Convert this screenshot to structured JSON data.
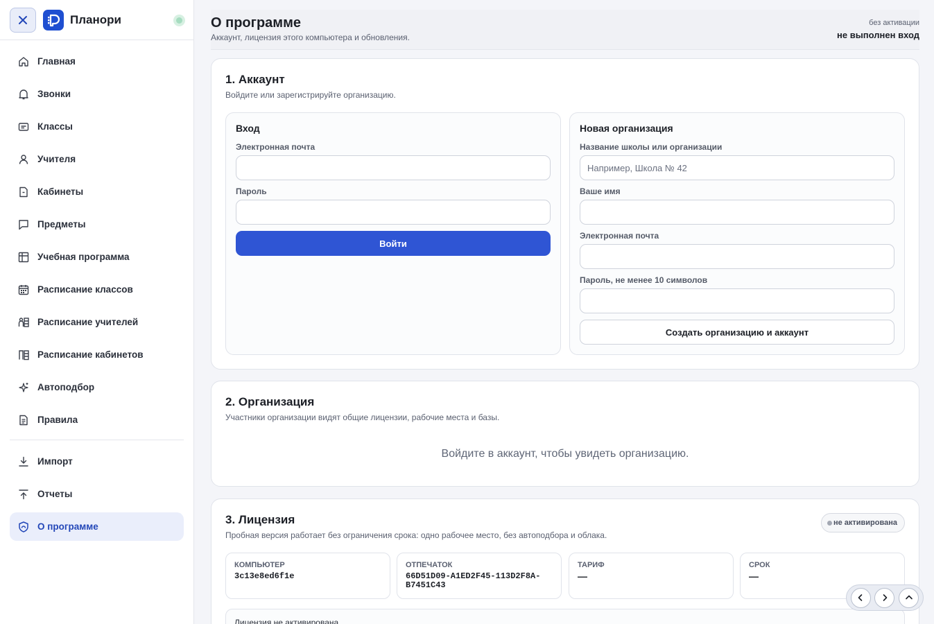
{
  "app": {
    "title": "Планори"
  },
  "sidebar": {
    "items": [
      {
        "label": "Главная",
        "icon": "home-icon"
      },
      {
        "label": "Звонки",
        "icon": "bell-icon"
      },
      {
        "label": "Классы",
        "icon": "class-card-icon"
      },
      {
        "label": "Учителя",
        "icon": "user-icon"
      },
      {
        "label": "Кабинеты",
        "icon": "door-icon"
      },
      {
        "label": "Предметы",
        "icon": "chat-bubble-icon"
      },
      {
        "label": "Учебная программа",
        "icon": "table-grid-icon"
      },
      {
        "label": "Расписание классов",
        "icon": "calendar-icon"
      },
      {
        "label": "Расписание учителей",
        "icon": "teacher-schedule-icon"
      },
      {
        "label": "Расписание кабинетов",
        "icon": "room-schedule-icon"
      },
      {
        "label": "Автоподбор",
        "icon": "sparkles-icon"
      },
      {
        "label": "Правила",
        "icon": "document-icon"
      }
    ],
    "bottom_items": [
      {
        "label": "Импорт",
        "icon": "download-icon"
      },
      {
        "label": "Отчеты",
        "icon": "upload-icon"
      },
      {
        "label": "О программе",
        "icon": "shield-icon",
        "active": true
      }
    ]
  },
  "header": {
    "title": "О программе",
    "subtitle": "Аккаунт, лицензия этого компьютера и обновления.",
    "activation_status": "без активации",
    "login_status": "не выполнен вход"
  },
  "account": {
    "title": "1. Аккаунт",
    "subtitle": "Войдите или зарегистрируйте организацию.",
    "login": {
      "title": "Вход",
      "email_label": "Электронная почта",
      "email_value": "",
      "password_label": "Пароль",
      "password_value": "",
      "submit_label": "Войти"
    },
    "register": {
      "title": "Новая организация",
      "org_label": "Название школы или организации",
      "org_placeholder": "Например, Школа № 42",
      "name_label": "Ваше имя",
      "email_label": "Электронная почта",
      "password_label": "Пароль, не менее 10 символов",
      "submit_label": "Создать организацию и аккаунт"
    }
  },
  "organization": {
    "title": "2. Организация",
    "subtitle": "Участники организации видят общие лицензии, рабочие места и базы.",
    "empty_message": "Войдите в аккаунт, чтобы увидеть организацию."
  },
  "license": {
    "title": "3. Лицензия",
    "subtitle": "Пробная версия работает без ограничения срока: одно рабочее место, без автоподбора и облака.",
    "status_badge": "не активирована",
    "computer_label": "КОМПЬЮТЕР",
    "computer_value": "3c13e8ed6f1e",
    "fingerprint_label": "ОТПЕЧАТОК",
    "fingerprint_value": "66D51D09-A1ED2F45-113D2F8A-B7451C43",
    "plan_label": "ТАРИФ",
    "plan_value": "—",
    "term_label": "СРОК",
    "term_value": "—",
    "note": "Лицензия не активирована"
  },
  "colors": {
    "accent": "#2f55d4",
    "active_nav_bg": "#eaeefb",
    "active_nav_text": "#2347b8",
    "logo": "#1f4fd1"
  }
}
